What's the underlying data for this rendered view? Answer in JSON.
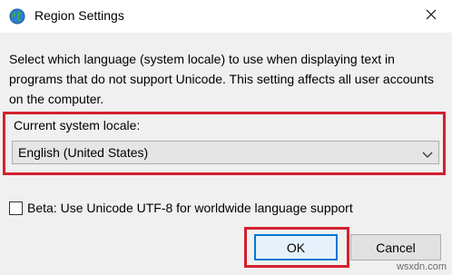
{
  "window": {
    "title": "Region Settings",
    "icon": "globe-icon",
    "close_icon": "close-icon"
  },
  "description": "Select which language (system locale) to use when displaying text in programs that do not support Unicode. This setting affects all user accounts on the computer.",
  "locale": {
    "label": "Current system locale:",
    "selected": "English (United States)"
  },
  "beta": {
    "label": "Beta: Use Unicode UTF-8 for worldwide language support",
    "checked": false
  },
  "buttons": {
    "ok": "OK",
    "cancel": "Cancel"
  },
  "watermark": "wsxdn.com",
  "colors": {
    "highlight": "#d3202f",
    "focus": "#0078d7"
  }
}
